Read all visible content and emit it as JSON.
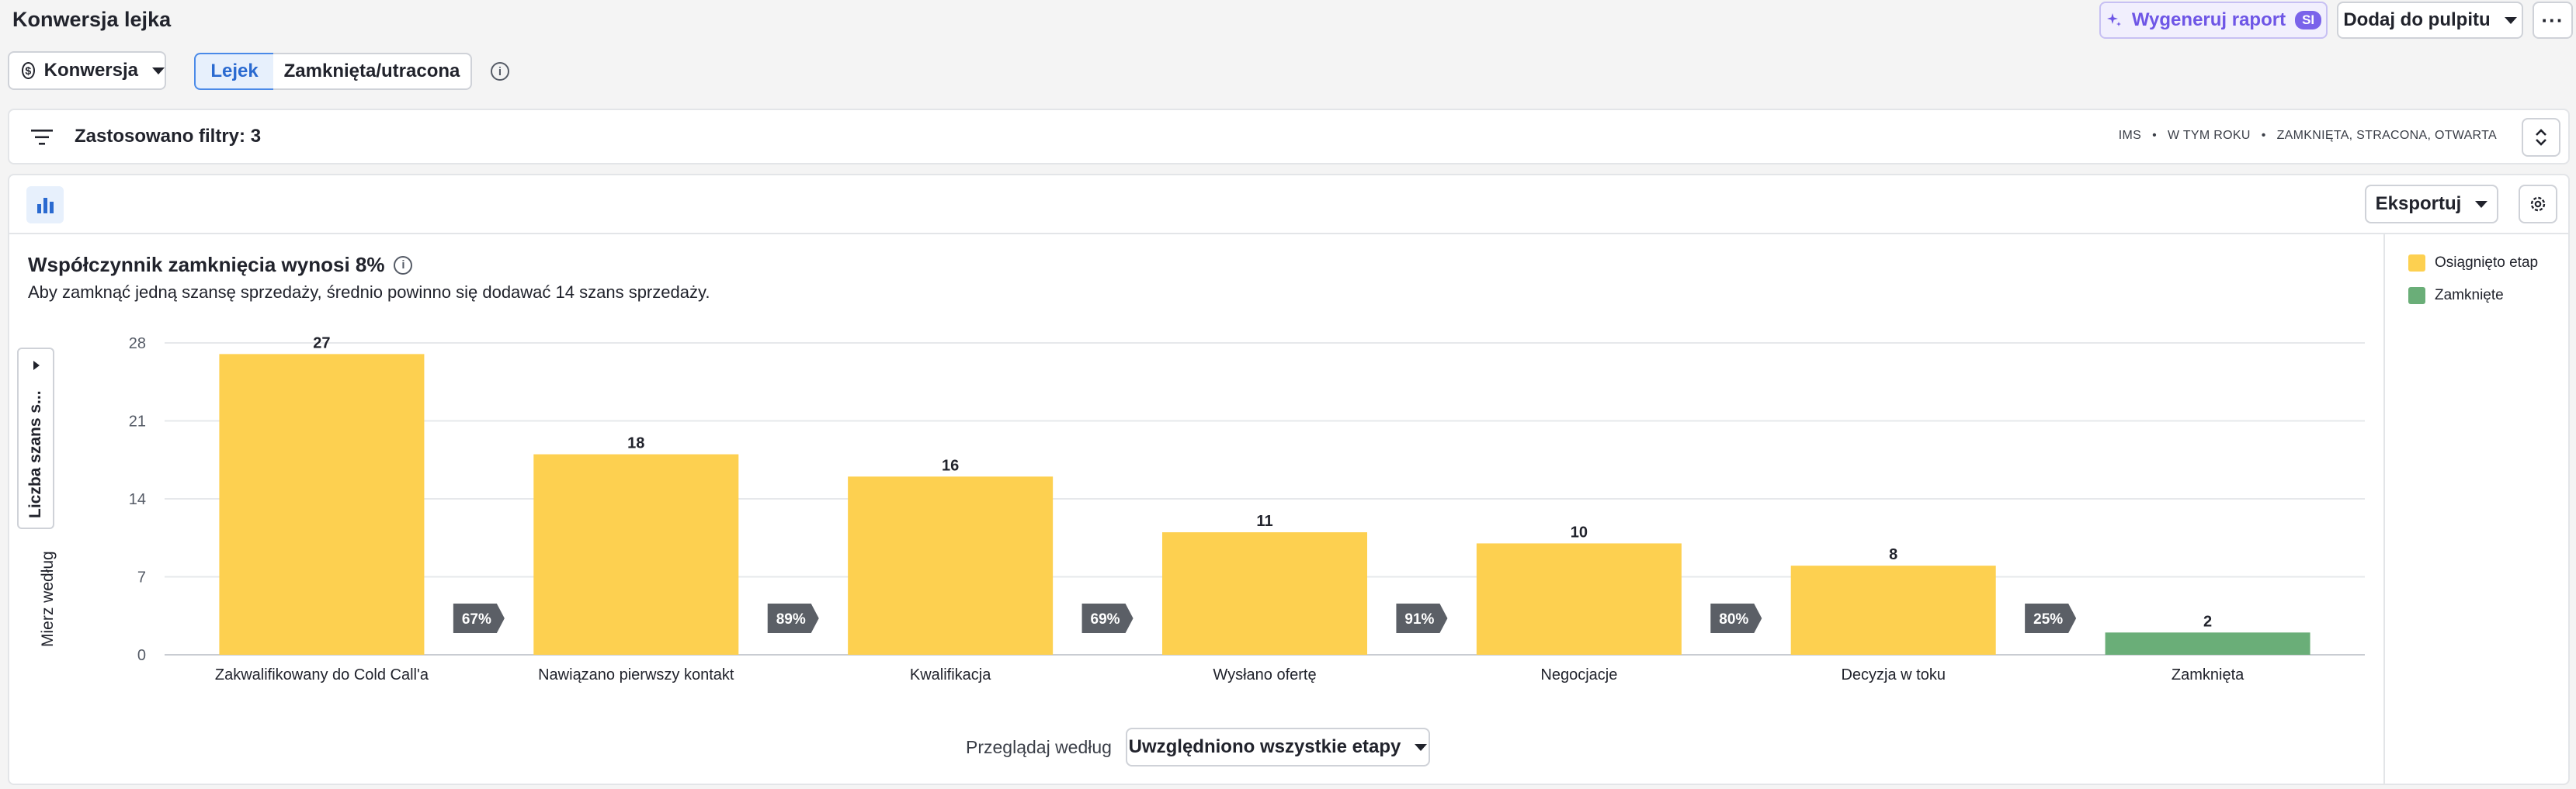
{
  "page": {
    "title": "Konwersja lejka"
  },
  "header": {
    "ai_button_label": "Wygeneruj raport",
    "ai_badge": "SI",
    "add_button_label": "Dodaj do pulpitu",
    "more_label": "···"
  },
  "controls": {
    "metric_label": "Konwersja",
    "metric_icon_glyph": "$",
    "tabs": [
      {
        "label": "Lejek",
        "active": true
      },
      {
        "label": "Zamknięta/utracona",
        "active": false
      }
    ]
  },
  "filters": {
    "label": "Zastosowano filtry: 3",
    "tags": [
      "IMS",
      "W TYM ROKU",
      "ZAMKNIĘTA, STRACONA, OTWARTA"
    ],
    "separator": "•"
  },
  "toolbar": {
    "export_label": "Eksportuj"
  },
  "summary": {
    "headline": "Współczynnik zamknięcia wynosi 8%",
    "subline": "Aby zamknąć jedną szansę sprzedaży, średnio powinno się dodawać 14 szans sprzedaży."
  },
  "measure": {
    "label": "Mierz według",
    "value": "Liczba szans s..."
  },
  "legend": [
    {
      "label": "Osiągnięto etap",
      "color": "#fdd050"
    },
    {
      "label": "Zamknięte",
      "color": "#6aae78"
    }
  ],
  "chart_data": {
    "type": "bar",
    "categories": [
      "Zakwalifikowany do Cold Call'a",
      "Nawiązano pierwszy kontakt",
      "Kwalifikacja",
      "Wysłano ofertę",
      "Negocjacje",
      "Decyzja w toku",
      "Zamknięta"
    ],
    "values": [
      27,
      18,
      16,
      11,
      10,
      8,
      2
    ],
    "series_of_bar": [
      "reached",
      "reached",
      "reached",
      "reached",
      "reached",
      "reached",
      "closed"
    ],
    "conversion_rates": [
      "67%",
      "89%",
      "69%",
      "91%",
      "80%",
      "25%"
    ],
    "yticks": [
      0,
      7,
      14,
      21,
      28
    ],
    "ylim": [
      0,
      28
    ],
    "colors": {
      "reached": "#fdd050",
      "closed": "#6aae78"
    }
  },
  "footer": {
    "browse_label": "Przeglądaj według",
    "browse_value": "Uwzględniono wszystkie etapy"
  }
}
